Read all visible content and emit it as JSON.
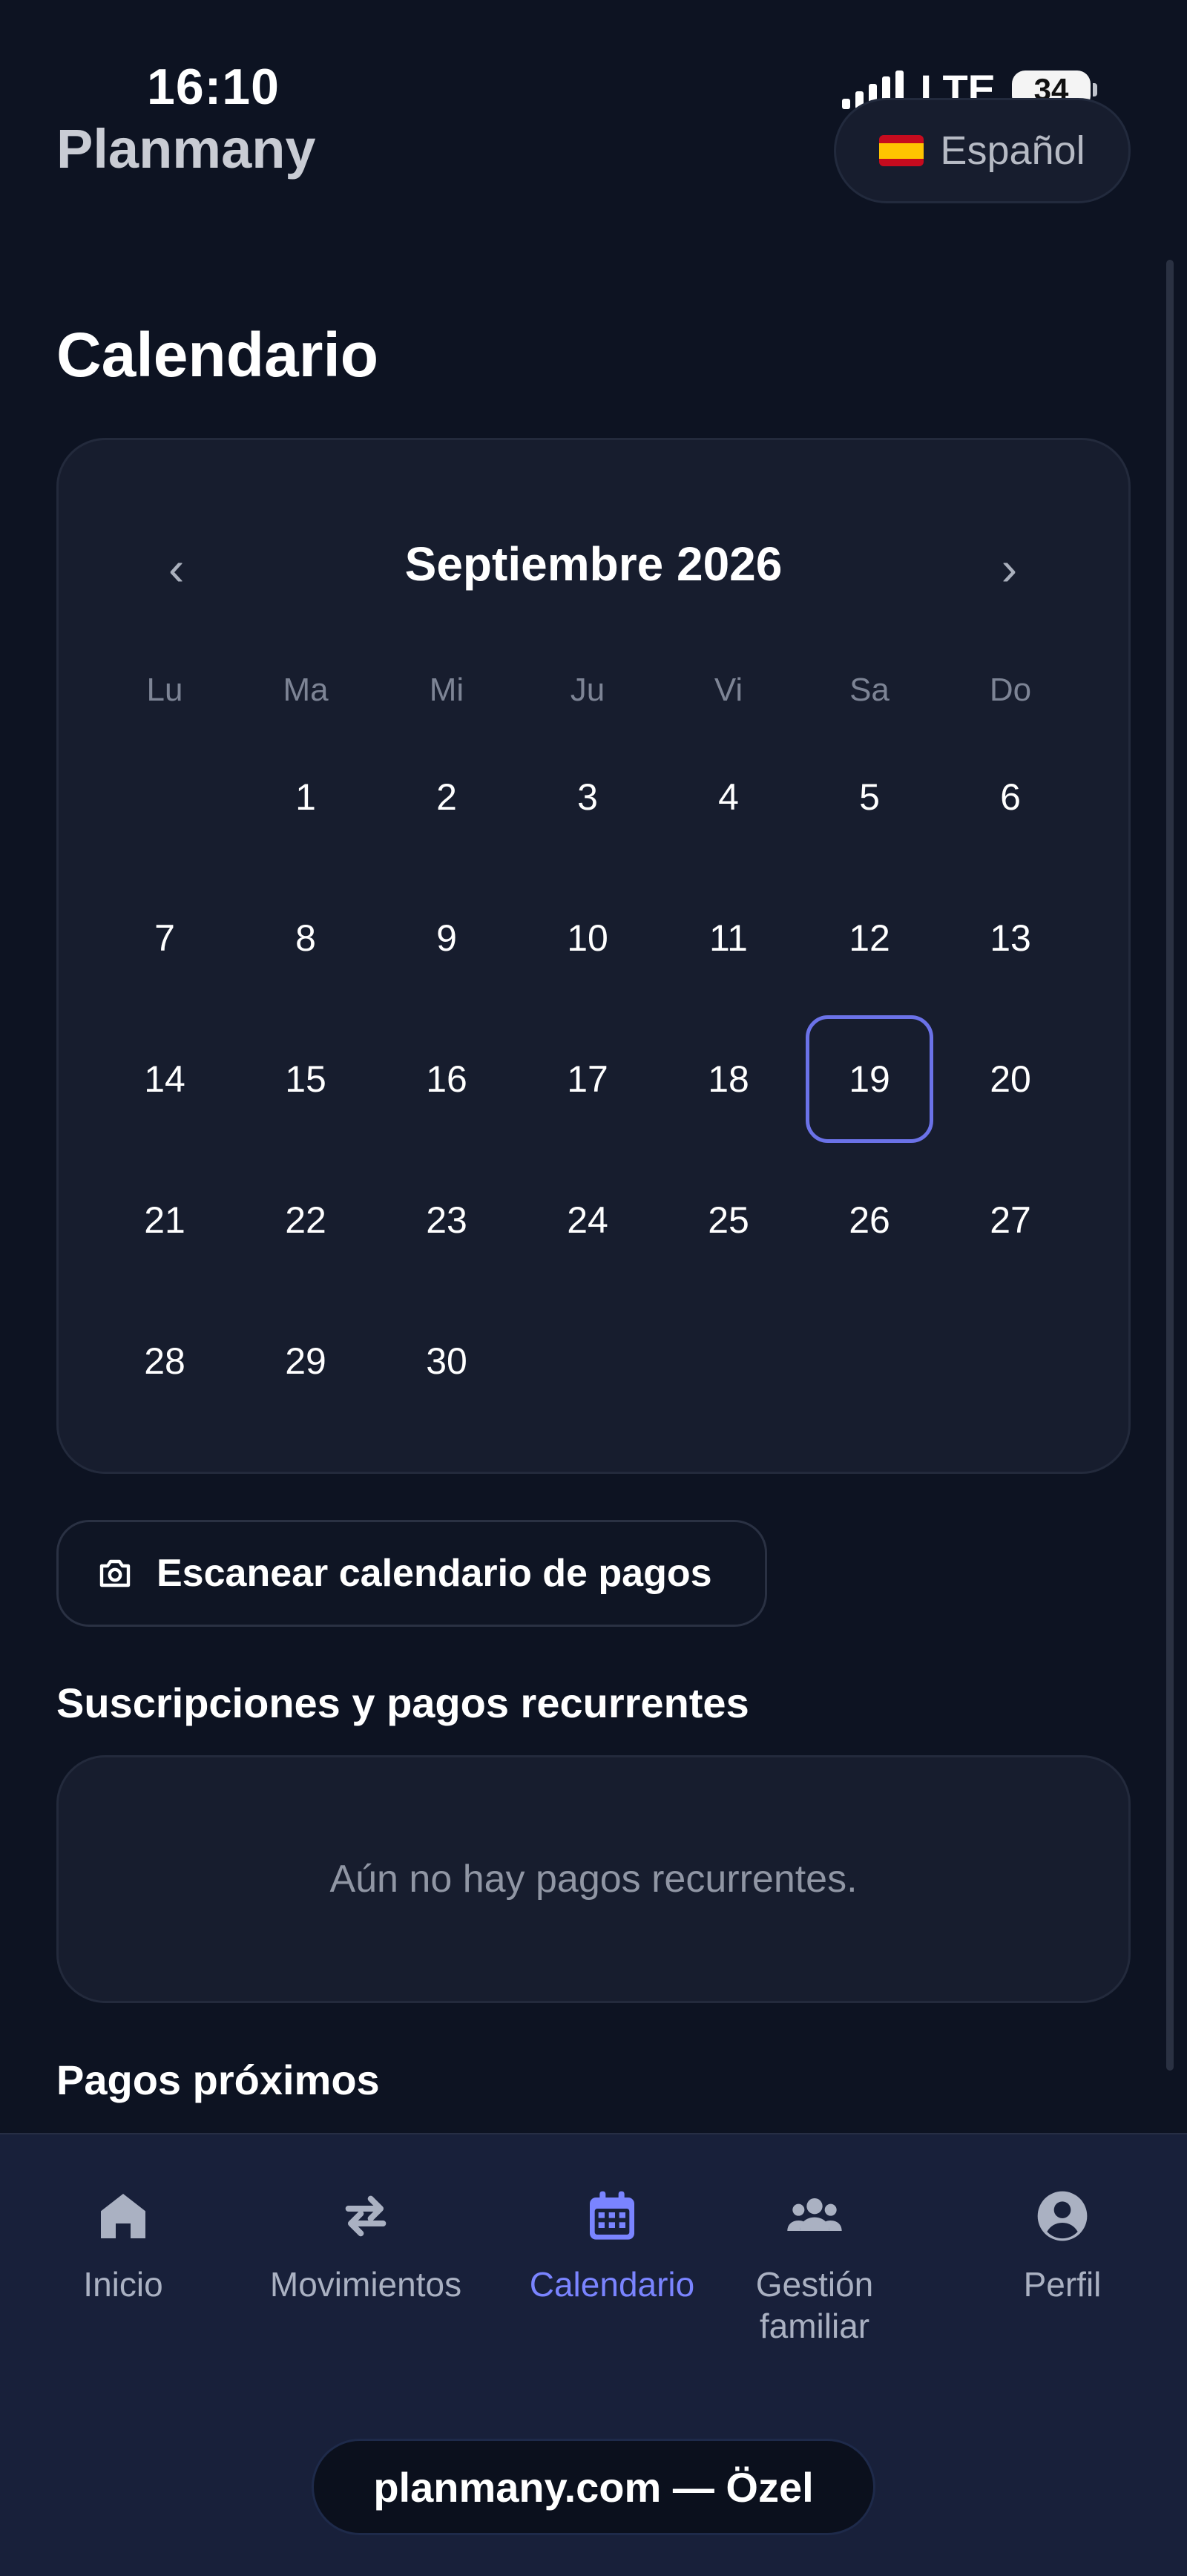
{
  "status_bar": {
    "time": "16:10",
    "network": "LTE",
    "battery": "34"
  },
  "header": {
    "brand": "Planmany",
    "language": {
      "label": "Español",
      "flag_icon": "spain-flag-icon"
    }
  },
  "page": {
    "title": "Calendario"
  },
  "calendar": {
    "month_label": "Septiembre 2026",
    "prev_label": "‹",
    "next_label": "›",
    "weekdays": [
      "Lu",
      "Ma",
      "Mi",
      "Ju",
      "Vi",
      "Sa",
      "Do"
    ],
    "first_weekday_offset": 1,
    "days_in_month": 30,
    "selected_day": 19,
    "selected_color": "#6b72e8"
  },
  "scan_button": {
    "label": "Escanear calendario de pagos",
    "icon": "camera-icon"
  },
  "subscriptions": {
    "title": "Suscripciones y pagos recurrentes",
    "empty_text": "Aún no hay pagos recurrentes."
  },
  "upcoming": {
    "title": "Pagos próximos"
  },
  "bottom_nav": {
    "items": [
      {
        "label": "Inicio",
        "icon": "home-icon"
      },
      {
        "label": "Movimientos",
        "icon": "swap-arrows-icon"
      },
      {
        "label": "Calendario",
        "icon": "calendar-icon",
        "active": true
      },
      {
        "label": "Gestión\nfamiliar",
        "icon": "group-icon"
      },
      {
        "label": "Perfil",
        "icon": "user-circle-icon"
      }
    ],
    "active_color": "#7a84ff"
  },
  "footer": {
    "label": "planmany.com — Özel"
  }
}
